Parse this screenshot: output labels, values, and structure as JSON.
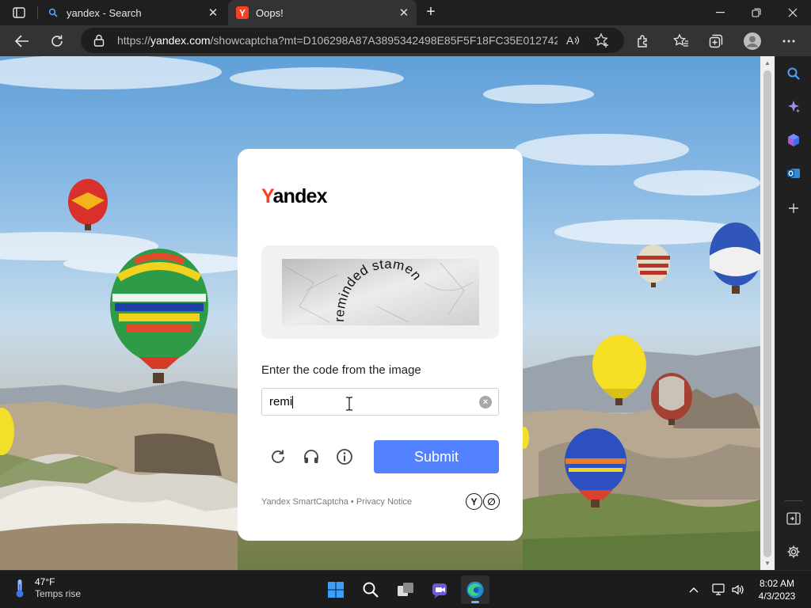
{
  "browser": {
    "tabs": [
      {
        "title": "yandex - Search",
        "favicon": "search-icon"
      },
      {
        "title": "Oops!",
        "favicon": "yandex-favicon"
      }
    ],
    "address": {
      "protocol": "https://",
      "host": "yandex.com",
      "path": "/showcaptcha?mt=D106298A87A3895342498E85F5F18FC35E012742..."
    },
    "toolbar_icons": [
      "back-arrow-icon",
      "refresh-icon",
      "lock-icon",
      "read-aloud-icon",
      "add-favorite-icon",
      "extensions-icon",
      "favorites-icon",
      "collections-icon",
      "profile-avatar",
      "more-menu-icon"
    ],
    "sidebar_icons": [
      "search-icon",
      "copilot-icon",
      "shopping-icon",
      "outlook-icon",
      "add-icon",
      "sidebar-toggle-icon",
      "settings-gear-icon"
    ]
  },
  "captcha": {
    "logo": {
      "first": "Y",
      "rest": "andex"
    },
    "image_text": "reminded stamen",
    "prompt": "Enter the code from the image",
    "input_value": "remi",
    "clear_symbol": "×",
    "submit_label": "Submit",
    "footer_brand": "Yandex SmartCaptcha",
    "footer_separator": " • ",
    "footer_link": "Privacy Notice",
    "logo_badge": [
      "Y",
      "∅"
    ],
    "accent_color": "#5282ff",
    "brand_color": "#fc3f1d"
  },
  "taskbar": {
    "weather_temp": "47°F",
    "weather_desc": "Temps rise",
    "time": "8:02 AM",
    "date": "4/3/2023"
  }
}
